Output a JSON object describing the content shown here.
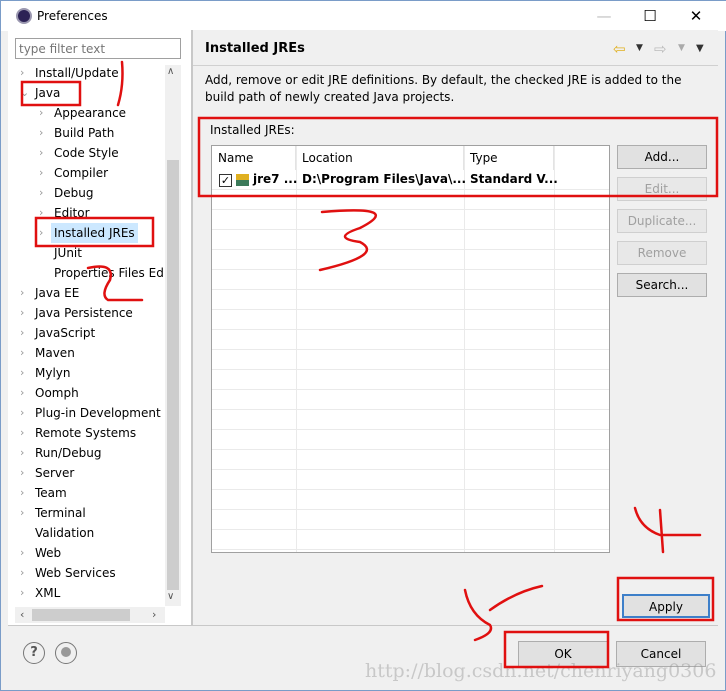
{
  "window": {
    "title": "Preferences",
    "minimize": "—",
    "maximize": "☐",
    "close": "✕"
  },
  "filter": {
    "placeholder": "type filter text"
  },
  "tree": [
    {
      "label": "Install/Update",
      "level": 0,
      "chevron": "›"
    },
    {
      "label": "Java",
      "level": 0,
      "chevron": "⌄"
    },
    {
      "label": "Appearance",
      "level": 1,
      "chevron": "›"
    },
    {
      "label": "Build Path",
      "level": 1,
      "chevron": "›"
    },
    {
      "label": "Code Style",
      "level": 1,
      "chevron": "›"
    },
    {
      "label": "Compiler",
      "level": 1,
      "chevron": "›"
    },
    {
      "label": "Debug",
      "level": 1,
      "chevron": "›"
    },
    {
      "label": "Editor",
      "level": 1,
      "chevron": "›"
    },
    {
      "label": "Installed JREs",
      "level": 1,
      "chevron": "›",
      "selected": true
    },
    {
      "label": "JUnit",
      "level": 1,
      "chevron": ""
    },
    {
      "label": "Properties Files Ed",
      "level": 1,
      "chevron": ""
    },
    {
      "label": "Java EE",
      "level": 0,
      "chevron": "›"
    },
    {
      "label": "Java Persistence",
      "level": 0,
      "chevron": "›"
    },
    {
      "label": "JavaScript",
      "level": 0,
      "chevron": "›"
    },
    {
      "label": "Maven",
      "level": 0,
      "chevron": "›"
    },
    {
      "label": "Mylyn",
      "level": 0,
      "chevron": "›"
    },
    {
      "label": "Oomph",
      "level": 0,
      "chevron": "›"
    },
    {
      "label": "Plug-in Development",
      "level": 0,
      "chevron": "›"
    },
    {
      "label": "Remote Systems",
      "level": 0,
      "chevron": "›"
    },
    {
      "label": "Run/Debug",
      "level": 0,
      "chevron": "›"
    },
    {
      "label": "Server",
      "level": 0,
      "chevron": "›"
    },
    {
      "label": "Team",
      "level": 0,
      "chevron": "›"
    },
    {
      "label": "Terminal",
      "level": 0,
      "chevron": "›"
    },
    {
      "label": "Validation",
      "level": 0,
      "chevron": ""
    },
    {
      "label": "Web",
      "level": 0,
      "chevron": "›"
    },
    {
      "label": "Web Services",
      "level": 0,
      "chevron": "›"
    },
    {
      "label": "XML",
      "level": 0,
      "chevron": "›"
    }
  ],
  "page": {
    "title": "Installed JREs",
    "description": "Add, remove or edit JRE definitions. By default, the checked JRE is added to the build path of newly created Java projects.",
    "table_label": "Installed JREs:",
    "columns": [
      "Name",
      "Location",
      "Type"
    ],
    "rows": [
      {
        "checked": true,
        "name": "jre7 ...",
        "location": "D:\\Program Files\\Java\\...",
        "type": "Standard V..."
      }
    ],
    "buttons": {
      "add": "Add...",
      "edit": "Edit...",
      "duplicate": "Duplicate...",
      "remove": "Remove",
      "search": "Search..."
    },
    "apply": "Apply"
  },
  "footer": {
    "help_icon": "?",
    "ok": "OK",
    "cancel": "Cancel"
  },
  "watermark": "http://blog.csdn.net/chenriyang0306",
  "colors": {
    "annotation": "#e01010",
    "selection": "#cce8ff"
  }
}
